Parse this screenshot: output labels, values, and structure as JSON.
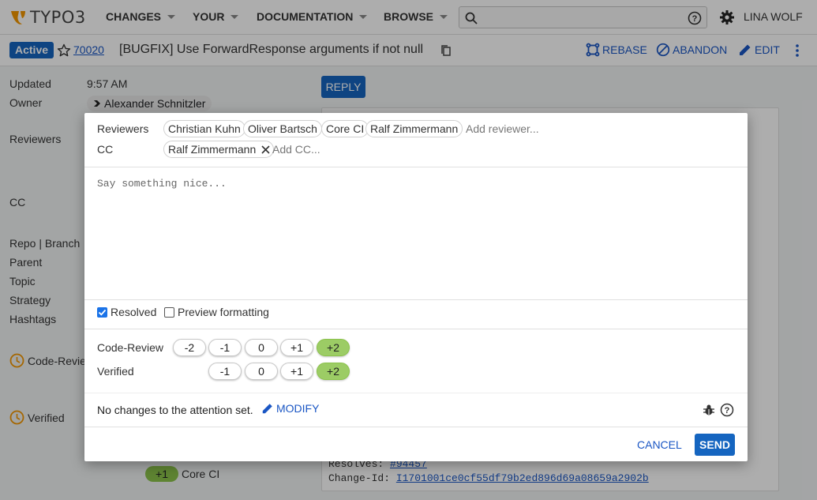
{
  "header": {
    "logo_text": "TYPO3",
    "nav": [
      {
        "label": "CHANGES"
      },
      {
        "label": "YOUR"
      },
      {
        "label": "DOCUMENTATION"
      },
      {
        "label": "BROWSE"
      }
    ],
    "search_placeholder": "",
    "user_name": "LINA WOLF"
  },
  "change": {
    "status": "Active",
    "number": "70020",
    "title": "[BUGFIX] Use ForwardResponse arguments if not null",
    "actions": {
      "rebase": "REBASE",
      "abandon": "ABANDON",
      "edit": "EDIT"
    }
  },
  "background": {
    "labels": {
      "updated": "Updated",
      "owner": "Owner",
      "reviewers": "Reviewers",
      "cc": "CC",
      "repo_branch": "Repo | Branch",
      "parent": "Parent",
      "topic": "Topic",
      "strategy": "Strategy",
      "hashtags": "Hashtags",
      "code_review": "Code-Review",
      "verified": "Verified"
    },
    "updated_value": "9:57 AM",
    "owner_name": "Alexander Schnitzler",
    "reply_label": "REPLY",
    "commit_resolves_label": "Resolves:",
    "commit_resolves_value": "#94457",
    "commit_changeid_label": "Change-Id:",
    "commit_changeid_value": "I1701001ce0cf55df79b2ed896d69a08659a2902b",
    "ci_vote": "+1",
    "ci_name": "Core CI"
  },
  "dialog": {
    "reviewers_label": "Reviewers",
    "reviewers": [
      "Christian Kuhn",
      "Oliver Bartsch",
      "Core CI",
      "Ralf Zimmermann"
    ],
    "add_reviewer_placeholder": "Add reviewer...",
    "cc_label": "CC",
    "cc": [
      "Ralf Zimmermann"
    ],
    "add_cc_placeholder": "Add CC...",
    "message_placeholder": "Say something nice...",
    "resolved_label": "Resolved",
    "resolved_checked": true,
    "preview_label": "Preview formatting",
    "preview_checked": false,
    "labels": [
      {
        "name": "Code-Review",
        "values": [
          "-2",
          "-1",
          "0",
          "+1",
          "+2"
        ],
        "selected": "+2"
      },
      {
        "name": "Verified",
        "values": [
          "-1",
          "0",
          "+1",
          "+2"
        ],
        "selected": "+2"
      }
    ],
    "attention_text": "No changes to the attention set.",
    "modify_label": "MODIFY",
    "cancel_label": "CANCEL",
    "send_label": "SEND"
  },
  "colors": {
    "accent": "#1565c0",
    "link": "#1a56c4",
    "vote_selected": "#9ccc65",
    "logo_orange": "#f49700"
  }
}
